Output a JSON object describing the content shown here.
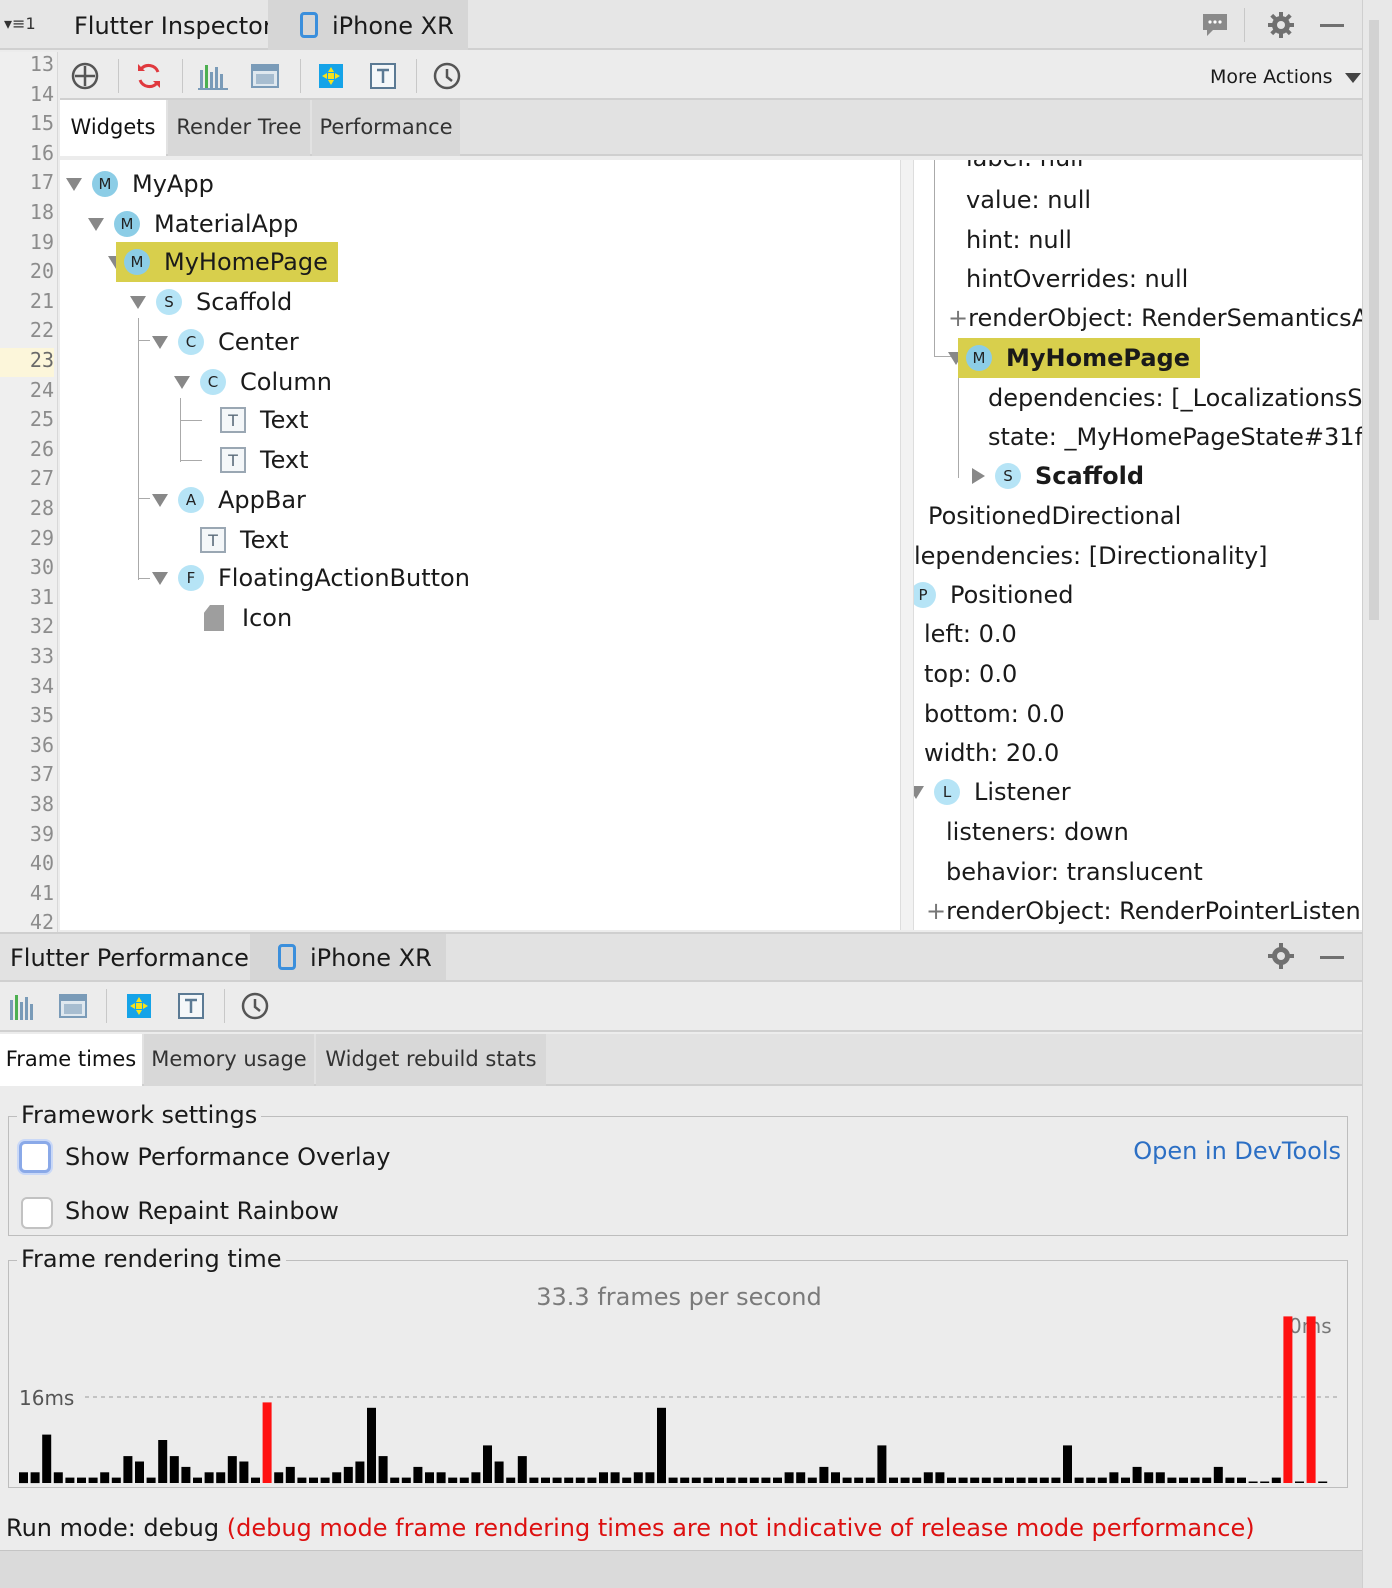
{
  "inspector": {
    "menu_label": "1",
    "title": "Flutter Inspector",
    "device": "iPhone XR",
    "more_actions": "More Actions",
    "tabs": [
      {
        "label": "Widgets",
        "selected": true
      },
      {
        "label": "Render Tree",
        "selected": false
      },
      {
        "label": "Performance",
        "selected": false
      }
    ]
  },
  "line_numbers": [
    "13",
    "14",
    "15",
    "16",
    "17",
    "18",
    "19",
    "20",
    "21",
    "22",
    "23",
    "24",
    "25",
    "26",
    "27",
    "28",
    "29",
    "30",
    "31",
    "32",
    "33",
    "34",
    "35",
    "36",
    "37",
    "38",
    "39",
    "40",
    "41",
    "42"
  ],
  "current_line": "23",
  "widget_tree": [
    {
      "label": "MyApp",
      "badge": "M"
    },
    {
      "label": "MaterialApp",
      "badge": "M"
    },
    {
      "label": "MyHomePage",
      "badge": "M",
      "highlighted": true
    },
    {
      "label": "Scaffold",
      "badge": "S"
    },
    {
      "label": "Center",
      "badge": "C"
    },
    {
      "label": "Column",
      "badge": "C"
    },
    {
      "label": "Text",
      "badge": "T"
    },
    {
      "label": "Text",
      "badge": "T"
    },
    {
      "label": "AppBar",
      "badge": "A"
    },
    {
      "label": "Text",
      "badge": "T"
    },
    {
      "label": "FloatingActionButton",
      "badge": "F"
    },
    {
      "label": "Icon",
      "badge": ""
    }
  ],
  "properties": {
    "label_partial": "label: null",
    "value": "value: null",
    "hint": "hint: null",
    "hint_overrides": "hintOverrides: null",
    "render_object_1": "renderObject: RenderSemanticsA",
    "my_home_page": {
      "badge": "M",
      "label": "MyHomePage"
    },
    "dependencies_1": "dependencies: [_LocalizationsS",
    "state": "state: _MyHomePageState#31f",
    "scaffold": {
      "badge": "S",
      "label": "Scaffold"
    },
    "positioned_directional": "PositionedDirectional",
    "dependencies_2": "lependencies: [Directionality]",
    "positioned": {
      "badge": "P",
      "label": "Positioned"
    },
    "left": "left: 0.0",
    "top": "top: 0.0",
    "bottom": "bottom: 0.0",
    "width": "width: 20.0",
    "listener": {
      "badge": "L",
      "label": "Listener"
    },
    "listeners": "listeners: down",
    "behavior": "behavior: translucent",
    "render_object_2": "renderObject: RenderPointerListen",
    "plus": "+"
  },
  "performance": {
    "title": "Flutter Performance",
    "device": "iPhone XR",
    "tabs": [
      {
        "label": "Frame times",
        "selected": true
      },
      {
        "label": "Memory usage",
        "selected": false
      },
      {
        "label": "Widget rebuild stats",
        "selected": false
      }
    ],
    "framework_settings": {
      "legend": "Framework settings",
      "show_performance_overlay": {
        "label": "Show Performance Overlay",
        "checked": false
      },
      "show_repaint_rainbow": {
        "label": "Show Repaint Rainbow",
        "checked": false
      },
      "open_devtools": "Open in DevTools"
    },
    "frame_rendering": {
      "legend": "Frame rendering time",
      "fps": "33.3 frames per second",
      "threshold_label": "16ms",
      "top_label": "0ms"
    },
    "run_mode": "Run mode: debug",
    "run_mode_warning": "(debug mode frame rendering times are not indicative of release mode performance)"
  },
  "colors": {
    "highlight": "#d8cf4c",
    "badge": "#b6e4f6",
    "slow_frame": "#ff1010",
    "frame": "#000000",
    "link": "#2c6fc4",
    "warning": "#dd1111"
  },
  "chart_data": {
    "type": "bar",
    "threshold_ms": 16,
    "values": [
      2,
      2,
      9,
      2,
      1,
      1,
      1,
      2,
      1,
      5,
      4,
      1,
      8,
      5,
      3,
      1,
      2,
      2,
      5,
      4,
      1,
      15,
      2,
      3,
      1,
      1,
      1,
      2,
      3,
      4,
      14,
      5,
      1,
      1,
      3,
      2,
      2,
      1,
      1,
      2,
      7,
      4,
      1,
      5,
      1,
      1,
      1,
      1,
      1,
      1,
      2,
      2,
      1,
      2,
      2,
      14,
      1,
      1,
      1,
      1,
      1,
      1,
      1,
      1,
      1,
      1,
      2,
      2,
      1,
      3,
      2,
      1,
      1,
      1,
      7,
      1,
      1,
      1,
      2,
      2,
      1,
      1,
      1,
      1,
      1,
      1,
      1,
      1,
      1,
      1,
      7,
      1,
      1,
      1,
      2,
      1,
      3,
      2,
      2,
      1,
      1,
      1,
      1,
      3,
      1,
      1,
      0,
      0,
      1,
      31,
      0,
      31,
      0
    ],
    "slow_indices": [
      21,
      109,
      111
    ]
  }
}
